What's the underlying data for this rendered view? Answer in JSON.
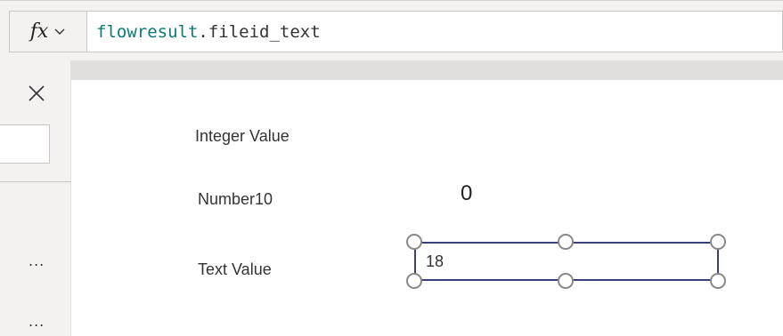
{
  "formula_bar": {
    "fx_label": "fx",
    "formula_variable": "flowresult",
    "formula_rest": ".fileid_text"
  },
  "left_pane": {
    "more_label_1": "...",
    "more_label_2": "..."
  },
  "canvas": {
    "integer_label": "Integer Value",
    "number_label": "Number10",
    "number_value": "0",
    "text_label": "Text Value",
    "text_input_value": "18"
  },
  "colors": {
    "formula_variable": "#0b7a75",
    "selection_border": "#3b3f7a",
    "canvas_background": "#ffffff",
    "chrome_background": "#f3f2f1"
  },
  "icons": {
    "close": "close-icon",
    "dropdown": "chevron-down-icon",
    "more": "more-icon"
  }
}
